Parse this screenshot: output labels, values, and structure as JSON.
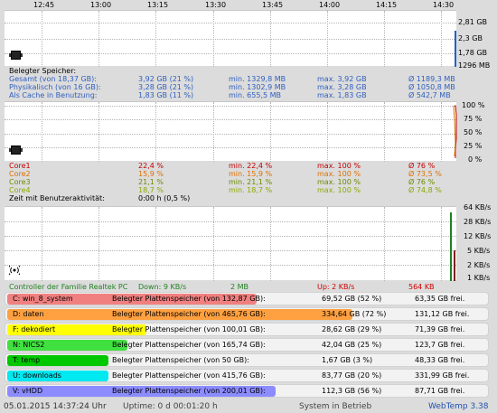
{
  "time_axis": [
    "12:45",
    "13:00",
    "13:15",
    "13:30",
    "13:45",
    "14:00",
    "14:15",
    "14:30"
  ],
  "memory": {
    "y_labels": [
      "2,81 GB",
      "2,3 GB",
      "1,78 GB",
      "1296 MB"
    ],
    "title": "Belegter Speicher:",
    "rows": [
      {
        "label": "Gesamt (von 18,37 GB):",
        "value": "3,92 GB (21 %)",
        "min": "min. 1329,8 MB",
        "max": "max. 3,92 GB",
        "avg": "Ø 1189,3 MB"
      },
      {
        "label": "Physikalisch (von 16 GB):",
        "value": "3,28 GB (21 %)",
        "min": "min. 1302,9 MB",
        "max": "max. 3,28 GB",
        "avg": "Ø 1050,8 MB"
      },
      {
        "label": "Als Cache in Benutzung:",
        "value": "1,83 GB (11 %)",
        "min": "min. 655,5 MB",
        "max": "max. 1,83 GB",
        "avg": "Ø 542,7 MB"
      }
    ]
  },
  "cpu": {
    "y_labels": [
      "100 %",
      "75 %",
      "50 %",
      "25 %",
      "0 %"
    ],
    "rows": [
      {
        "label": "Core1",
        "value": "22,4 %",
        "min": "min. 22,4 %",
        "max": "max. 100 %",
        "avg": "Ø 76 %",
        "color": "#c00000"
      },
      {
        "label": "Core2",
        "value": "15,9 %",
        "min": "min. 15,9 %",
        "max": "max. 100 %",
        "avg": "Ø 73,5 %",
        "color": "#e07000"
      },
      {
        "label": "Core3",
        "value": "21,1 %",
        "min": "min. 21,1 %",
        "max": "max. 100 %",
        "avg": "Ø 76 %",
        "color": "#6a8a00"
      },
      {
        "label": "Core4",
        "value": "18,7 %",
        "min": "min. 18,7 %",
        "max": "max. 100 %",
        "avg": "Ø 74,8 %",
        "color": "#8aaa00"
      }
    ],
    "idle_label": "Zeit mit Benutzeraktivität:",
    "idle_value": "0:00 h (0,5 %)"
  },
  "network": {
    "y_labels": [
      "64 KB/s",
      "28 KB/s",
      "12 KB/s",
      "5 KB/s",
      "2 KB/s",
      "1 KB/s"
    ],
    "adapter": "Controller der Familie Realtek PC",
    "down": "Down: 9 KB/s",
    "down_total": "2 MB",
    "up": "Up: 2 KB/s",
    "up_total": "564 KB"
  },
  "disks": [
    {
      "name": "C: win_8_system",
      "label": "Belegter Plattenspeicher (von 132,87 GB):",
      "used": "69,52 GB (52 %)",
      "free": "63,35 GB frei.",
      "color": "#f08080",
      "pct": 52
    },
    {
      "name": "D: daten",
      "label": "Belegter Plattenspeicher (von 465,76 GB):",
      "used": "334,64 GB (72 %)",
      "free": "131,12 GB frei.",
      "color": "#ffa040",
      "pct": 72
    },
    {
      "name": "F: dekodiert",
      "label": "Belegter Plattenspeicher (von 100,01 GB):",
      "used": "28,62 GB (29 %)",
      "free": "71,39 GB frei.",
      "color": "#ffff00",
      "pct": 29
    },
    {
      "name": "N: NICS2",
      "label": "Belegter Plattenspeicher (von 165,74 GB):",
      "used": "42,04 GB (25 %)",
      "free": "123,7 GB frei.",
      "color": "#40e040",
      "pct": 25
    },
    {
      "name": "T: temp",
      "label": "Belegter Plattenspeicher (von 50 GB):",
      "used": "1,67 GB (3 %)",
      "free": "48,33 GB frei.",
      "color": "#00c800",
      "pct": 3
    },
    {
      "name": "U: downloads",
      "label": "Belegter Plattenspeicher (von 415,76 GB):",
      "used": "83,77 GB (20 %)",
      "free": "331,99 GB frei.",
      "color": "#00e8f0",
      "pct": 20
    },
    {
      "name": "V: vHDD",
      "label": "Belegter Plattenspeicher (von 200,01 GB):",
      "used": "112,3 GB (56 %)",
      "free": "87,71 GB frei.",
      "color": "#8c8cff",
      "pct": 56
    }
  ],
  "status": {
    "datetime": "05.01.2015 14:37:24 Uhr",
    "uptime": "Uptime: 0 d 00:01:20 h",
    "system": "System in Betrieb",
    "version": "WebTemp 3.38"
  },
  "colors": {
    "mem_text": "#3060c0",
    "net_down": "#208020",
    "net_up": "#d00000"
  }
}
